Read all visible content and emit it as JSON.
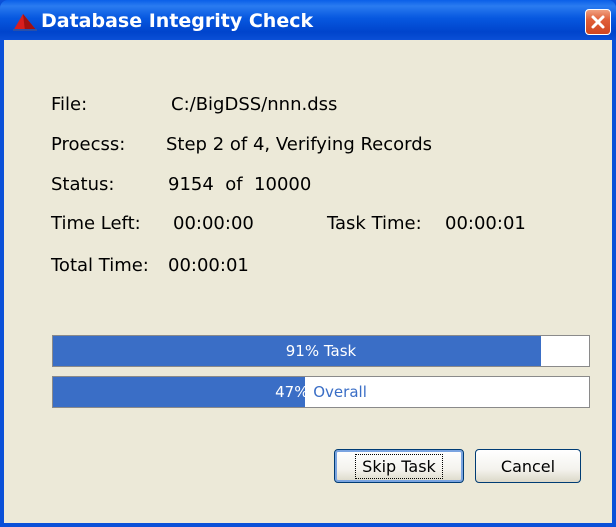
{
  "window": {
    "title": "Database Integrity Check",
    "icons": {
      "app": "red-triangle-app-icon",
      "close": "close-x-icon"
    },
    "colors": {
      "titlebar": "#0050d8",
      "client": "#ece9d8",
      "progress_fill": "#3a6ec6",
      "close": "#e0603a"
    }
  },
  "info": {
    "file_label": "File:",
    "file_value": "C:/BigDSS/nnn.dss",
    "process_label": "Proecss:",
    "process_value": "Step 2 of 4, Verifying Records",
    "status_label": "Status:",
    "status_value": "9154  of  10000",
    "time_left_label": "Time Left:",
    "time_left_value": "00:00:00",
    "task_time_label": "Task Time:",
    "task_time_value": "00:00:01",
    "total_time_label": "Total Time:",
    "total_time_value": "00:00:01"
  },
  "progress": {
    "task": {
      "percent": 91,
      "label": "91% Task"
    },
    "overall": {
      "percent": 47,
      "label_left": "47%",
      "label_right": " Overall"
    }
  },
  "buttons": {
    "skip_task": "Skip Task",
    "cancel": "Cancel"
  }
}
